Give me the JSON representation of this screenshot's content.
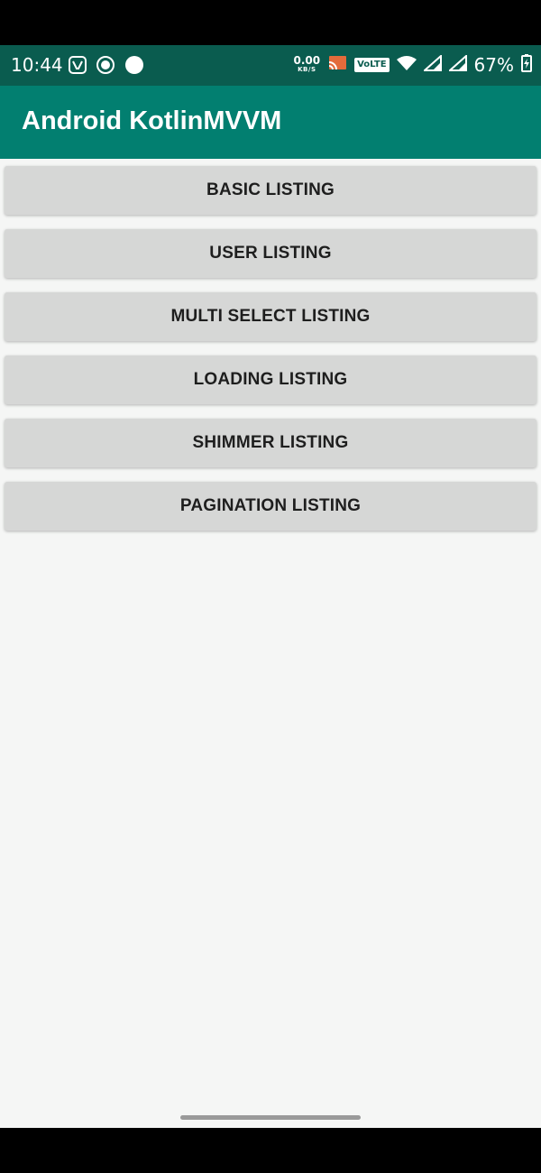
{
  "status_bar": {
    "time": "10:44",
    "left_icons": [
      "saavn-icon",
      "record-icon",
      "dot-icon"
    ],
    "net_speed_value": "0.00",
    "net_speed_unit": "KB/S",
    "volte_label": "VoLTE",
    "battery_percent": "67%",
    "bg_color": "#0a5c4f"
  },
  "app_bar": {
    "title": "Android KotlinMVVM",
    "bg_color": "#027f70"
  },
  "buttons": [
    {
      "label": "BASIC LISTING"
    },
    {
      "label": "USER LISTING"
    },
    {
      "label": "MULTI SELECT LISTING"
    },
    {
      "label": "LOADING LISTING"
    },
    {
      "label": "SHIMMER LISTING"
    },
    {
      "label": "PAGINATION LISTING"
    }
  ],
  "colors": {
    "content_bg": "#f5f6f5",
    "button_bg": "#d6d7d6",
    "button_text": "#1e1e1e"
  }
}
